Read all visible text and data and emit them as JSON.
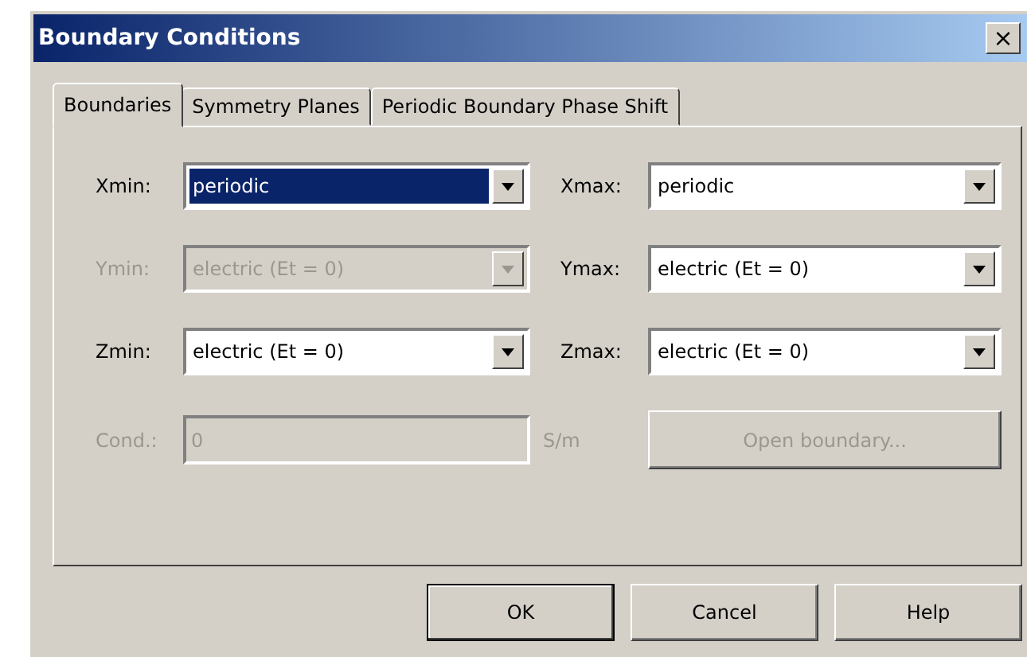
{
  "window": {
    "title": "Boundary Conditions",
    "close": "×"
  },
  "tabs": [
    {
      "label": "Boundaries",
      "selected": true
    },
    {
      "label": "Symmetry Planes",
      "selected": false
    },
    {
      "label": "Periodic Boundary Phase Shift",
      "selected": false
    }
  ],
  "boundaries": [
    {
      "label": "Xmin:",
      "value": "periodic",
      "disabled": false,
      "selected": true
    },
    {
      "label": "Xmax:",
      "value": "periodic",
      "disabled": false,
      "selected": false
    },
    {
      "label": "Ymin:",
      "value": "electric (Et = 0)",
      "disabled": true,
      "selected": false
    },
    {
      "label": "Ymax:",
      "value": "electric (Et = 0)",
      "disabled": false,
      "selected": false
    },
    {
      "label": "Zmin:",
      "value": "electric (Et = 0)",
      "disabled": false,
      "selected": false
    },
    {
      "label": "Zmax:",
      "value": "electric (Et = 0)",
      "disabled": false,
      "selected": false
    }
  ],
  "conductivity": {
    "label": "Cond.:",
    "value": "0",
    "unit": "S/m",
    "disabled": true
  },
  "open_boundary": {
    "label": "Open boundary...",
    "disabled": true
  },
  "buttons": [
    {
      "label": "OK",
      "default": true
    },
    {
      "label": "Cancel",
      "default": false
    },
    {
      "label": "Help",
      "default": false
    }
  ]
}
